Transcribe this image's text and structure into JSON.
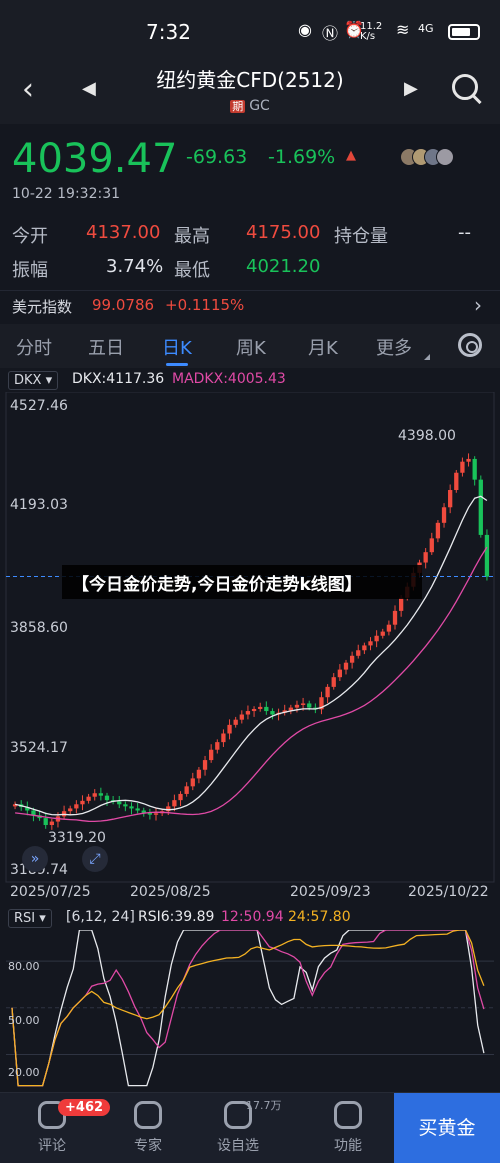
{
  "status_bar": {
    "time": "7:32",
    "net_speed": "11.2 K/s",
    "signal": "4G"
  },
  "header": {
    "title": "纽约黄金CFD(2512)",
    "tag": "期",
    "code": "GC"
  },
  "quote": {
    "price": "4039.47",
    "change": "-69.63",
    "change_pct": "-1.69%",
    "datetime": "10-22 19:32:31",
    "open_label": "今开",
    "open": "4137.00",
    "high_label": "最高",
    "high": "4175.00",
    "oi_label": "持仓量",
    "oi": "--",
    "amp_label": "振幅",
    "amp": "3.74%",
    "low_label": "最低",
    "low": "4021.20"
  },
  "usd_index": {
    "label": "美元指数",
    "value": "99.0786",
    "change": "+0.1115%"
  },
  "tabs": [
    "分时",
    "五日",
    "日K",
    "周K",
    "月K",
    "更多"
  ],
  "active_tab": "日K",
  "indicator": {
    "name": "DKX",
    "dkx": "DKX:4117.36",
    "madkx": "MADKX:4005.43"
  },
  "banner": "【今日金价走势,今日金价走势k线图】",
  "chart_data": {
    "type": "candlestick",
    "y_axis_labels": [
      "4527.46",
      "4193.03",
      "3858.60",
      "3524.17",
      "3189.74"
    ],
    "ylim": [
      3189.74,
      4527.46
    ],
    "x_labels": [
      "2025/07/25",
      "2025/08/25",
      "2025/09/23",
      "2025/10/22"
    ],
    "max_label": "4398.00",
    "min_label": "3319.20",
    "last_price": 4039.47,
    "closes": [
      3380,
      3372,
      3362,
      3348,
      3340,
      3320,
      3330,
      3345,
      3360,
      3368,
      3380,
      3390,
      3402,
      3412,
      3405,
      3392,
      3388,
      3380,
      3374,
      3368,
      3362,
      3355,
      3350,
      3354,
      3360,
      3374,
      3392,
      3410,
      3432,
      3455,
      3480,
      3508,
      3538,
      3560,
      3585,
      3610,
      3625,
      3640,
      3650,
      3656,
      3662,
      3650,
      3640,
      3645,
      3652,
      3660,
      3668,
      3672,
      3660,
      3655,
      3690,
      3720,
      3748,
      3770,
      3790,
      3810,
      3826,
      3840,
      3852,
      3868,
      3880,
      3900,
      3940,
      3978,
      4010,
      4050,
      4080,
      4110,
      4150,
      4195,
      4240,
      4290,
      4340,
      4372,
      4380,
      4320,
      4160,
      4039
    ]
  },
  "rsi": {
    "name": "RSI",
    "params": "[6,12, 24]",
    "rsi6": "RSI6:39.89",
    "rsi12": "12:50.94",
    "rsi24": "24:57.80",
    "levels": [
      "80.00",
      "50.00",
      "20.00"
    ]
  },
  "bottom_bar": {
    "comment": "评论",
    "comment_badge": "+462",
    "expert": "专家",
    "watch": "设自选",
    "watch_count": "17.7万",
    "func": "功能",
    "buy": "买黄金"
  }
}
